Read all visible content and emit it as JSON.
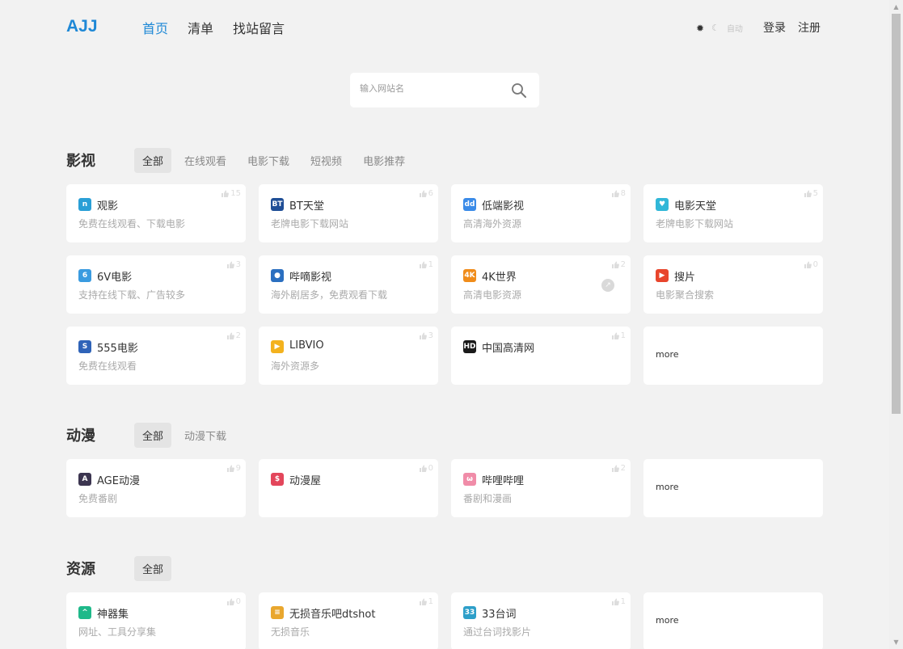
{
  "header": {
    "logo": "AJJ",
    "nav": [
      {
        "label": "首页",
        "active": true
      },
      {
        "label": "清单",
        "active": false
      },
      {
        "label": "找站留言",
        "active": false
      }
    ],
    "theme_auto_label": "自动",
    "login_label": "登录",
    "register_label": "注册"
  },
  "search": {
    "placeholder": "输入网站名"
  },
  "sections": [
    {
      "title": "影视",
      "tabs": [
        "全部",
        "在线观看",
        "电影下载",
        "短视频",
        "电影推荐"
      ],
      "active_tab": 0,
      "cards": [
        {
          "name": "观影",
          "desc": "免费在线观看、下载电影",
          "likes": "15",
          "icon": "film-icon",
          "icon_color": "#2a9fd6",
          "icon_text": "n"
        },
        {
          "name": "BT天堂",
          "desc": "老牌电影下载网站",
          "likes": "6",
          "icon": "bt-icon",
          "icon_color": "#1f4e96",
          "icon_text": "BT"
        },
        {
          "name": "低端影视",
          "desc": "高清海外资源",
          "likes": "8",
          "icon": "dd-icon",
          "icon_color": "#3b8be8",
          "icon_text": "dd"
        },
        {
          "name": "电影天堂",
          "desc": "老牌电影下载网站",
          "likes": "5",
          "icon": "heart-logo-icon",
          "icon_color": "#31b7d8",
          "icon_text": "♥"
        },
        {
          "name": "6V电影",
          "desc": "支持在线下载、广告较多",
          "likes": "3",
          "icon": "six-icon",
          "icon_color": "#3a9be0",
          "icon_text": "6"
        },
        {
          "name": "哔嘀影视",
          "desc": "海外剧居多，免费观看下载",
          "likes": "1",
          "icon": "tv-icon",
          "icon_color": "#2b6fc0",
          "icon_text": "●"
        },
        {
          "name": "4K世界",
          "desc": "高清电影资源",
          "likes": "2",
          "icon": "4k-icon",
          "icon_color": "#f08c1a",
          "icon_text": "4K",
          "pin": true
        },
        {
          "name": "搜片",
          "desc": "电影聚合搜索",
          "likes": "0",
          "icon": "play-icon",
          "icon_color": "#e8452c",
          "icon_text": "▶"
        },
        {
          "name": "555电影",
          "desc": "免费在线观看",
          "likes": "2",
          "icon": "s-icon",
          "icon_color": "#2f63b8",
          "icon_text": "S"
        },
        {
          "name": "LIBVIO",
          "desc": "海外资源多",
          "likes": "3",
          "icon": "libvio-icon",
          "icon_color": "#f3b21e",
          "icon_text": "▶"
        },
        {
          "name": "中国高清网",
          "desc": "",
          "likes": "1",
          "icon": "hd-icon",
          "icon_color": "#1a1a1a",
          "icon_text": "HD"
        },
        {
          "name": "more",
          "more": true
        }
      ]
    },
    {
      "title": "动漫",
      "tabs": [
        "全部",
        "动漫下载"
      ],
      "active_tab": 0,
      "cards": [
        {
          "name": "AGE动漫",
          "desc": "免费番剧",
          "likes": "9",
          "icon": "age-icon",
          "icon_color": "#3c3550",
          "icon_text": "A"
        },
        {
          "name": "动漫屋",
          "desc": "",
          "likes": "0",
          "icon": "dmw-icon",
          "icon_color": "#e3465b",
          "icon_text": "$"
        },
        {
          "name": "哔哩哔哩",
          "desc": "番剧和漫画",
          "likes": "2",
          "icon": "bilibili-icon",
          "icon_color": "#f08ca8",
          "icon_text": "ω"
        },
        {
          "name": "more",
          "more": true
        }
      ]
    },
    {
      "title": "资源",
      "tabs": [
        "全部"
      ],
      "active_tab": 0,
      "cards": [
        {
          "name": "神器集",
          "desc": "网址、工具分享集",
          "likes": "0",
          "icon": "arrow-up-icon",
          "icon_color": "#1fb98a",
          "icon_text": "^"
        },
        {
          "name": "无损音乐吧dtshot",
          "desc": "无损音乐",
          "likes": "1",
          "icon": "coin-icon",
          "icon_color": "#e9a72e",
          "icon_text": "≡"
        },
        {
          "name": "33台词",
          "desc": "通过台词找影片",
          "likes": "1",
          "icon": "33-icon",
          "icon_color": "#2e9fc9",
          "icon_text": "33"
        },
        {
          "name": "more",
          "more": true
        }
      ]
    }
  ]
}
